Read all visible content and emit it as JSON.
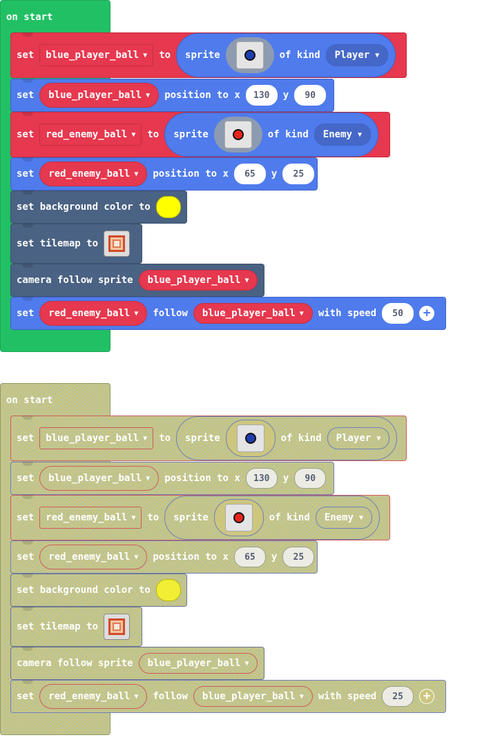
{
  "stacks": [
    {
      "hat_label": "on start",
      "b1": {
        "set": "set",
        "var": "blue_player_ball",
        "to": "to",
        "sprite": "sprite",
        "of_kind": "of kind",
        "kind": "Player",
        "dot_color": "#1e3fae"
      },
      "b2": {
        "set": "set",
        "var": "blue_player_ball",
        "pos": "position to x",
        "x": "130",
        "y_label": "y",
        "y": "90"
      },
      "b3": {
        "set": "set",
        "var": "red_enemy_ball",
        "to": "to",
        "sprite": "sprite",
        "of_kind": "of kind",
        "kind": "Enemy",
        "dot_color": "#e8261d"
      },
      "b4": {
        "set": "set",
        "var": "red_enemy_ball",
        "pos": "position to x",
        "x": "65",
        "y_label": "y",
        "y": "25"
      },
      "b5": {
        "label": "set background color to",
        "color": "#ffff00"
      },
      "b6": {
        "label": "set tilemap to"
      },
      "b7": {
        "label": "camera follow sprite",
        "var": "blue_player_ball"
      },
      "b8": {
        "set": "set",
        "var": "red_enemy_ball",
        "follow": "follow",
        "target": "blue_player_ball",
        "speed_label": "with speed",
        "speed": "50"
      }
    },
    {
      "hat_label": "on start",
      "b1": {
        "set": "set",
        "var": "blue_player_ball",
        "to": "to",
        "sprite": "sprite",
        "of_kind": "of kind",
        "kind": "Player",
        "dot_color": "#1e3fae"
      },
      "b2": {
        "set": "set",
        "var": "blue_player_ball",
        "pos": "position to x",
        "x": "130",
        "y_label": "y",
        "y": "90"
      },
      "b3": {
        "set": "set",
        "var": "red_enemy_ball",
        "to": "to",
        "sprite": "sprite",
        "of_kind": "of kind",
        "kind": "Enemy",
        "dot_color": "#e8261d"
      },
      "b4": {
        "set": "set",
        "var": "red_enemy_ball",
        "pos": "position to x",
        "x": "65",
        "y_label": "y",
        "y": "25"
      },
      "b5": {
        "label": "set background color to",
        "color": "#f1ee35"
      },
      "b6": {
        "label": "set tilemap to"
      },
      "b7": {
        "label": "camera follow sprite",
        "var": "blue_player_ball"
      },
      "b8": {
        "set": "set",
        "var": "red_enemy_ball",
        "follow": "follow",
        "target": "blue_player_ball",
        "speed_label": "with speed",
        "speed": "25"
      }
    }
  ]
}
